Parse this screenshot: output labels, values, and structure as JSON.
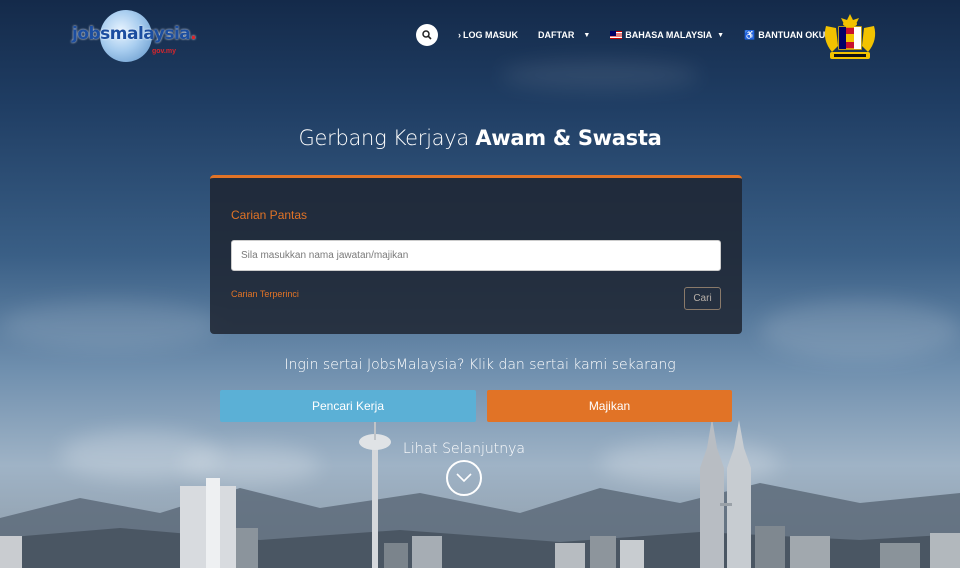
{
  "header": {
    "logo": {
      "brand": "jobsmalaysia",
      "tagline": "",
      "gov": "gov.my"
    },
    "nav": {
      "search_icon": "search-icon",
      "login": "LOG MASUK",
      "register": "DAFTAR",
      "language": "BAHASA MALAYSIA",
      "oku_help": "BANTUAN OKU",
      "login_icon": "chevron-right-icon",
      "oku_icon": "wheelchair-icon",
      "language_flag": "malaysia-flag-icon"
    }
  },
  "hero": {
    "title_light": "Gerbang Kerjaya ",
    "title_bold": "Awam & Swasta"
  },
  "search_panel": {
    "title": "Carian Pantas",
    "input_placeholder": "Sila masukkan nama jawatan/majikan",
    "input_value": "",
    "advanced_link": "Carian Terperinci",
    "search_button": "Cari"
  },
  "cta": {
    "join_text": "Ingin sertai JobsMalaysia? Klik dan sertai kami sekarang",
    "job_seeker_button": "Pencari Kerja",
    "employer_button": "Majikan",
    "more_text": "Lihat Selanjutnya",
    "more_icon": "chevron-down-icon"
  },
  "colors": {
    "accent_orange": "#e17326",
    "seeker_blue": "#5bb0d6",
    "panel_bg": "#1e2532"
  }
}
